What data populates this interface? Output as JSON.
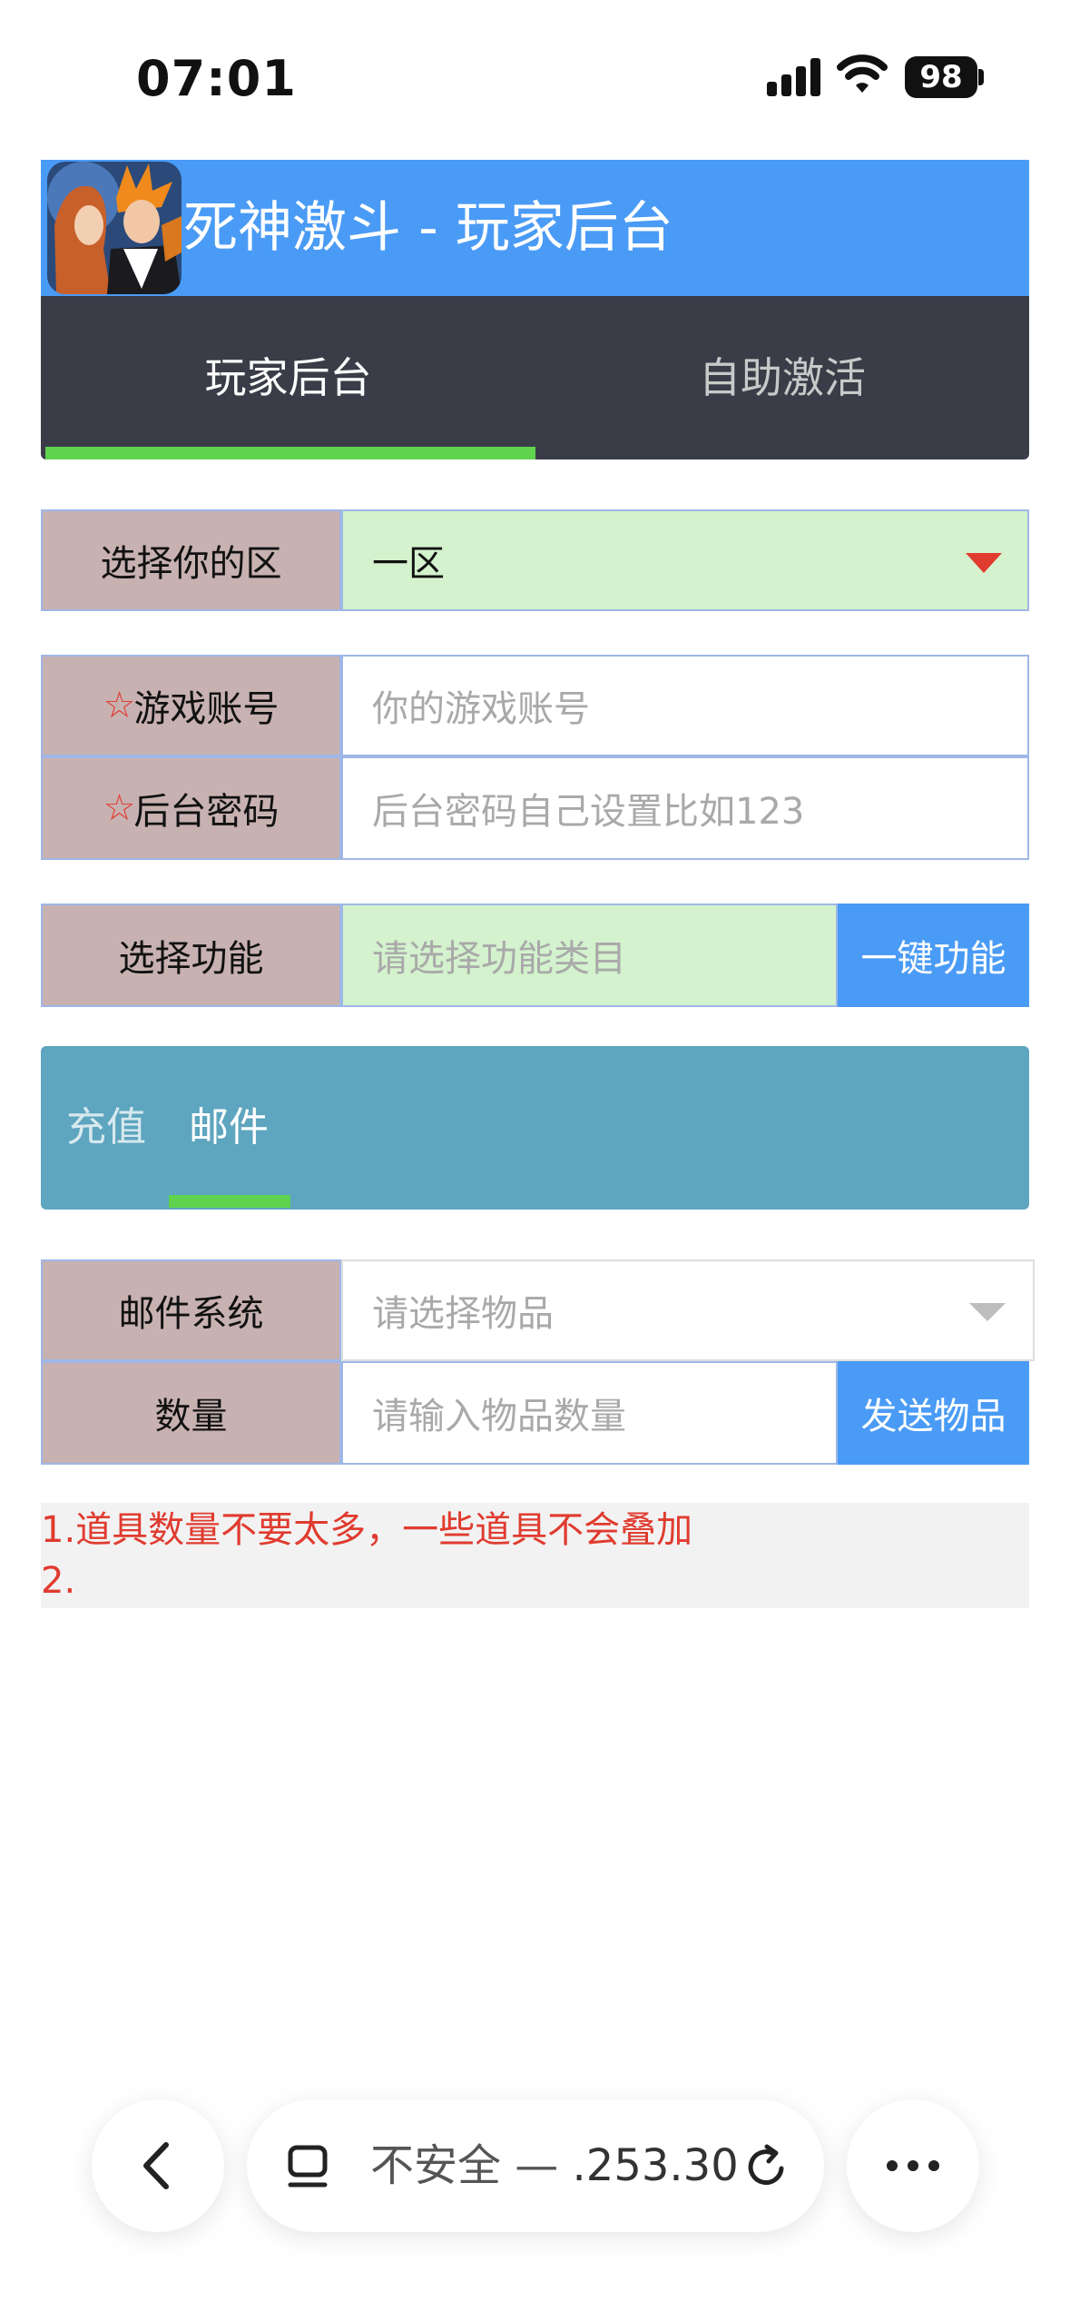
{
  "status_bar": {
    "time": "07:01",
    "battery": "98"
  },
  "header": {
    "title": "死神激斗 - 玩家后台"
  },
  "nav": {
    "tabs": [
      {
        "label": "玩家后台",
        "active": true
      },
      {
        "label": "自助激活",
        "active": false
      }
    ]
  },
  "form": {
    "server_label": "选择你的区",
    "server_value": "一区",
    "account_label": "游戏账号",
    "account_placeholder": "你的游戏账号",
    "password_label": "后台密码",
    "password_placeholder": "后台密码自己设置比如123",
    "required_mark": "☆",
    "function_label": "选择功能",
    "function_placeholder": "请选择功能类目",
    "function_button": "一键功能"
  },
  "subtabs": [
    {
      "label": "充值",
      "active": false
    },
    {
      "label": "邮件",
      "active": true
    }
  ],
  "mail": {
    "system_label": "邮件系统",
    "item_placeholder": "请选择物品",
    "quantity_label": "数量",
    "quantity_placeholder": "请输入物品数量",
    "send_button": "发送物品"
  },
  "notes": {
    "line1": "1.道具数量不要太多，一些道具不会叠加",
    "line2": "2."
  },
  "browser": {
    "url_prefix": "不安全 — ",
    "url_visible": ".253.30"
  },
  "colors": {
    "header_blue": "#4a9bf5",
    "nav_dark": "#3a3d47",
    "indicator_green": "#5fd34e",
    "label_bg": "#c8b1b1",
    "field_green": "#d3f2cd",
    "subtab_teal": "#5ea5bf",
    "note_red": "#e03b2f"
  }
}
